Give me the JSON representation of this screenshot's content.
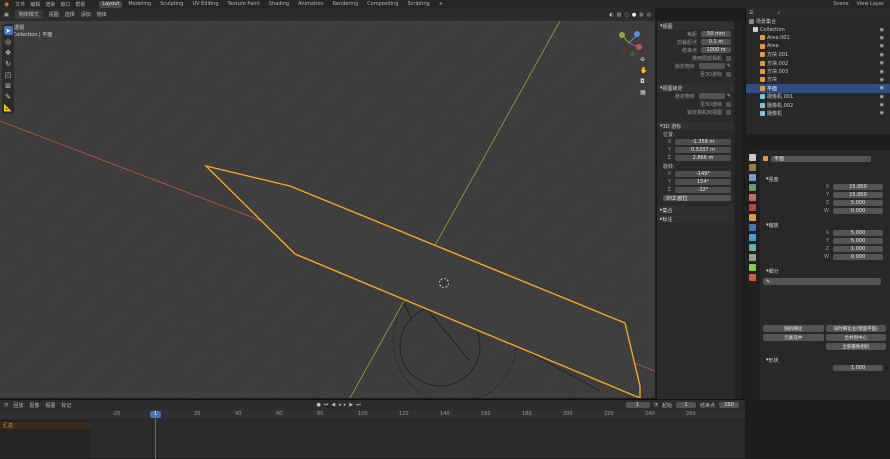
{
  "topbar": {
    "menus": [
      "文件",
      "编辑",
      "渲染",
      "窗口",
      "帮助"
    ],
    "tabs": [
      "Layout",
      "Modeling",
      "Sculpting",
      "UV Editing",
      "Texture Paint",
      "Shading",
      "Animation",
      "Rendering",
      "Compositing",
      "Scripting"
    ],
    "scene": "Scene",
    "view_layer": "View Layer"
  },
  "viewport_header": {
    "mode": "物体模式",
    "menus": [
      "视图",
      "选择",
      "添加",
      "物体"
    ]
  },
  "viewport": {
    "view_name": "用户透视",
    "collection": "(1) Collection | 平面"
  },
  "npanel": {
    "view_header": "视图",
    "lens_label": "焦距",
    "lens_value": "50 mm",
    "clip_start_label": "剪裁起点",
    "clip_start_value": "0.1 m",
    "clip_end_label": "结束点",
    "clip_end_value": "1000 m",
    "local_camera_label": "使用局部相机",
    "lock_label": "锁定物体",
    "lock_cursor_label": "至3D游标",
    "section_view_lock": "视图锁定",
    "lock_camera_label": "锁定相机到视图",
    "section_3d_cursor": "3D 游标",
    "location_label": "位置:",
    "cursor_x": "-1.358 m",
    "cursor_y": "0.5337 m",
    "cursor_z": "2.866 m",
    "rotation_label": "旋转:",
    "rot_x": "-149°",
    "rot_y": "154°",
    "rot_z": "-32°",
    "rot_mode": "XYZ 欧拉",
    "section_collection": "集合",
    "section_annotation": "标注",
    "axis_x": "X",
    "axis_y": "Y",
    "axis_z": "Z"
  },
  "outliner": {
    "title": "场景集合",
    "items": [
      {
        "name": "Collection",
        "indent": 1,
        "color": "#cfcfcf"
      },
      {
        "name": "Area.001",
        "indent": 2,
        "color": "#e09b47"
      },
      {
        "name": "Area",
        "indent": 2,
        "color": "#e09b47"
      },
      {
        "name": "方块.001",
        "indent": 2,
        "color": "#e09b47"
      },
      {
        "name": "方块.002",
        "indent": 2,
        "color": "#e09b47"
      },
      {
        "name": "方块.003",
        "indent": 2,
        "color": "#e09b47"
      },
      {
        "name": "方块",
        "indent": 2,
        "color": "#e09b47"
      },
      {
        "name": "平面",
        "indent": 2,
        "color": "#e09b47",
        "selected": true
      },
      {
        "name": "摄像机.001",
        "indent": 2,
        "color": "#7ec3e0"
      },
      {
        "name": "摄像机.002",
        "indent": 2,
        "color": "#7ec3e0"
      },
      {
        "name": "摄像机",
        "indent": 2,
        "color": "#7ec3e0"
      }
    ]
  },
  "properties": {
    "object_name": "平面",
    "section_light": "强度",
    "fields_a": [
      {
        "label": "X",
        "value": "15.000"
      },
      {
        "label": "Y",
        "value": "15.000"
      },
      {
        "label": "Z",
        "value": "5.000"
      },
      {
        "label": "W",
        "value": "0.000"
      }
    ],
    "section_b": "缩放",
    "fields_b": [
      {
        "label": "X",
        "value": "5.000"
      },
      {
        "label": "Y",
        "value": "5.000"
      },
      {
        "label": "Z",
        "value": "1.000"
      },
      {
        "label": "W",
        "value": "0.000"
      }
    ],
    "section_c": "细分",
    "btn_a": "随机细化",
    "btn_b": "同时细化主(镜面平面)",
    "btn_c": "元素选中",
    "btn_d": "合并到中心",
    "btn_e": "全部摄像相机",
    "footer_section": "形状",
    "footer_value": "1.000"
  },
  "timeline": {
    "menus": [
      "回放",
      "抠像",
      "视图",
      "标记"
    ],
    "current_frame": "1",
    "start_label": "起始",
    "start": "1",
    "end_label": "结束点",
    "end": "250",
    "summary": "汇总",
    "ticks": [
      "-20",
      "0",
      "20",
      "40",
      "60",
      "80",
      "100",
      "120",
      "140",
      "160",
      "180",
      "200",
      "220",
      "240",
      "260"
    ]
  },
  "colors": {
    "accent": "#4772b3",
    "selection": "#f4a623",
    "x_axis": "#c55060",
    "y_axis": "#8caa3a"
  }
}
